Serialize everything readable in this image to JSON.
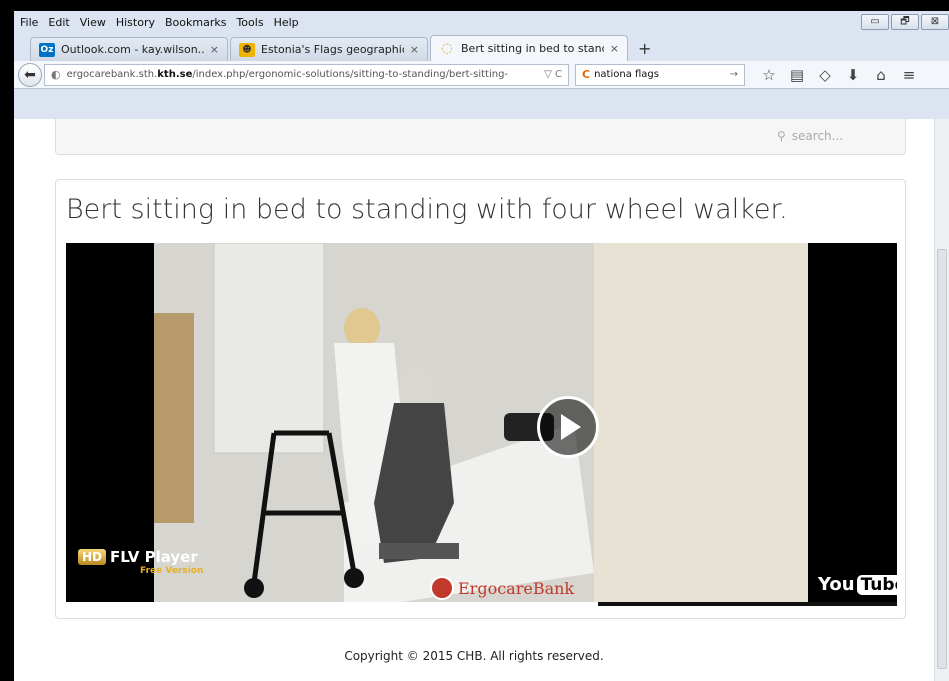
{
  "menubar": {
    "items": [
      "File",
      "Edit",
      "View",
      "History",
      "Bookmarks",
      "Tools",
      "Help"
    ]
  },
  "window_controls": {
    "minimize": "▭",
    "restore": "🗗",
    "close": "⊠"
  },
  "tabs": [
    {
      "label": "Outlook.com - kay.wilson...",
      "favicon": "Oz",
      "color": "#0072c6"
    },
    {
      "label": "Estonia's Flags geographic....",
      "favicon": "☻",
      "color": "#f0b400"
    },
    {
      "label": "Bert sitting in bed to standi...",
      "favicon": "◌",
      "color": "#e8a33b",
      "active": true
    }
  ],
  "tab_close": "×",
  "new_tab": "+",
  "navbar": {
    "url_prefix": "ergocarebank.sth.",
    "url_strong": "kth.se",
    "url_rest": "/index.php/ergonomic-solutions/sitting-to-standing/bert-sitting-",
    "url_actions": "▽ C",
    "search_text": "nationa flags",
    "search_go": "→"
  },
  "page": {
    "search_placeholder": "search...",
    "video_title": "Bert sitting in bed to standing with four wheel walker.",
    "copyright": "Copyright © 2015 CHB. All rights reserved."
  },
  "video": {
    "player_badge": "HD",
    "player_name": "FLV Player",
    "player_edition": "Free Version",
    "watermark": "ErgocareBank",
    "youtube_you": "You",
    "youtube_tube": "Tube",
    "progress": 0.64
  }
}
